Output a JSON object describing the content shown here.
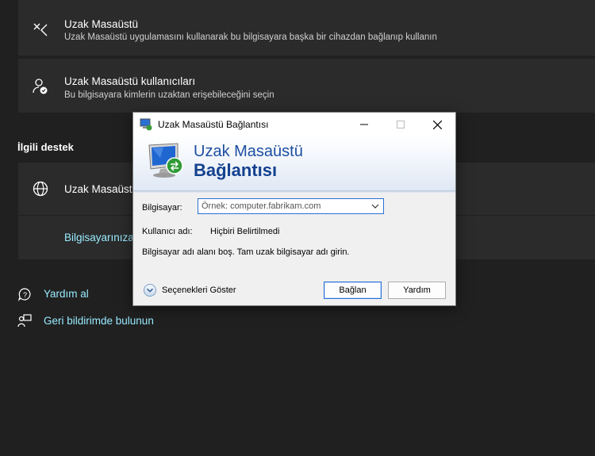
{
  "cards": [
    {
      "title": "Uzak Masaüstü",
      "subtitle": "Uzak Masaüstü uygulamasını kullanarak bu bilgisayara başka bir cihazdan bağlanıp kullanın",
      "icon": "remote-desktop-icon"
    },
    {
      "title": "Uzak Masaüstü kullanıcıları",
      "subtitle": "Bu bilgisayara kimlerin uzaktan erişebileceğini seçin",
      "icon": "user-check-icon"
    }
  ],
  "related_support": {
    "heading": "İlgili destek",
    "item_title": "Uzak Masaüstü",
    "item_link": "Bilgisayarınıza"
  },
  "help": {
    "get_help": "Yardım al",
    "feedback": "Geri bildirimde bulunun"
  },
  "dialog": {
    "title": "Uzak Masaüstü Bağlantısı",
    "banner_line1": "Uzak Masaüstü",
    "banner_line2": "Bağlantısı",
    "computer_label": "Bilgisayar:",
    "computer_placeholder": "Örnek: computer.fabrikam.com",
    "username_label": "Kullanıcı adı:",
    "username_value": "Hiçbiri Belirtilmedi",
    "message": "Bilgisayar adı alanı boş. Tam uzak bilgisayar adı girin.",
    "options_label": "Seçenekleri Göster",
    "connect_label": "Bağlan",
    "help_label": "Yardım"
  },
  "colors": {
    "accent_link": "#99ebff",
    "dialog_accent": "#2a6fd6",
    "background": "#202020",
    "card": "#2b2b2b"
  }
}
